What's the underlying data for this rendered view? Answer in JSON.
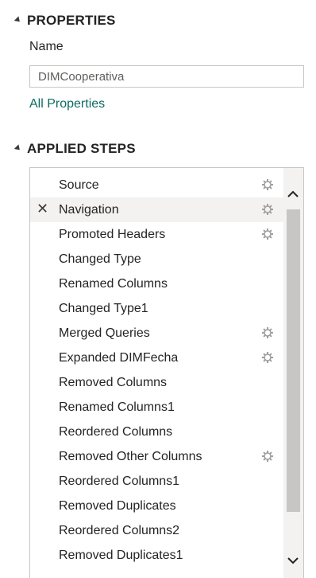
{
  "properties": {
    "header": "PROPERTIES",
    "name_label": "Name",
    "name_value": "DIMCooperativa",
    "all_properties_link": "All Properties"
  },
  "applied_steps": {
    "header": "APPLIED STEPS",
    "selected_index": 1,
    "steps": [
      {
        "label": "Source",
        "has_gear": true,
        "has_delete": false
      },
      {
        "label": "Navigation",
        "has_gear": true,
        "has_delete": true
      },
      {
        "label": "Promoted Headers",
        "has_gear": true,
        "has_delete": false
      },
      {
        "label": "Changed Type",
        "has_gear": false,
        "has_delete": false
      },
      {
        "label": "Renamed Columns",
        "has_gear": false,
        "has_delete": false
      },
      {
        "label": "Changed Type1",
        "has_gear": false,
        "has_delete": false
      },
      {
        "label": "Merged Queries",
        "has_gear": true,
        "has_delete": false
      },
      {
        "label": "Expanded DIMFecha",
        "has_gear": true,
        "has_delete": false
      },
      {
        "label": "Removed Columns",
        "has_gear": false,
        "has_delete": false
      },
      {
        "label": "Renamed Columns1",
        "has_gear": false,
        "has_delete": false
      },
      {
        "label": "Reordered Columns",
        "has_gear": false,
        "has_delete": false
      },
      {
        "label": "Removed Other Columns",
        "has_gear": true,
        "has_delete": false
      },
      {
        "label": "Reordered Columns1",
        "has_gear": false,
        "has_delete": false
      },
      {
        "label": "Removed Duplicates",
        "has_gear": false,
        "has_delete": false
      },
      {
        "label": "Reordered Columns2",
        "has_gear": false,
        "has_delete": false
      },
      {
        "label": "Removed Duplicates1",
        "has_gear": false,
        "has_delete": false
      }
    ]
  },
  "icons": {
    "collapse": "collapse-triangle-icon",
    "delete": "close-icon",
    "settings": "gear-icon",
    "scroll_up": "chevron-up-icon",
    "scroll_down": "chevron-down-icon"
  },
  "colors": {
    "link": "#0e6b62",
    "selected_row": "#f3f2f1",
    "scroll_thumb": "#c8c6c4",
    "gear": "#a19f9d"
  }
}
